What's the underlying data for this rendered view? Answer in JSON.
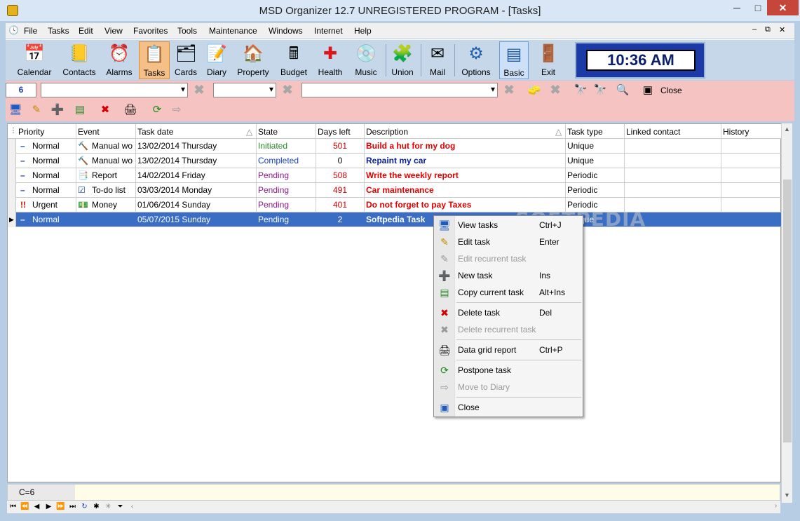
{
  "window": {
    "title": "MSD Organizer 12.7 UNREGISTERED PROGRAM - [Tasks]",
    "min_glyph": "─",
    "max_glyph": "□",
    "close_glyph": "✕"
  },
  "menubar": {
    "items": [
      "File",
      "Tasks",
      "Edit",
      "View",
      "Favorites",
      "Tools",
      "Maintenance",
      "Windows",
      "Internet",
      "Help"
    ],
    "mdi": [
      "–",
      "⧉",
      "✕"
    ]
  },
  "toolbar": {
    "buttons": [
      {
        "label": "Calendar",
        "icon": "calendar-icon",
        "glyph": "📅"
      },
      {
        "label": "Contacts",
        "icon": "contacts-icon",
        "glyph": "📒"
      },
      {
        "label": "Alarms",
        "icon": "alarm-clock-icon",
        "glyph": "⏰"
      },
      {
        "label": "Tasks",
        "icon": "tasks-icon",
        "glyph": "📋"
      },
      {
        "label": "Cards",
        "icon": "cards-icon",
        "glyph": "🗂"
      },
      {
        "label": "Diary",
        "icon": "diary-icon",
        "glyph": "📝"
      },
      {
        "label": "Property",
        "icon": "house-icon",
        "glyph": "🏠"
      },
      {
        "label": "Budget",
        "icon": "calculator-icon",
        "glyph": "🖩"
      },
      {
        "label": "Health",
        "icon": "health-cross-icon",
        "glyph": "✚"
      },
      {
        "label": "Music",
        "icon": "music-cd-icon",
        "glyph": "💿"
      },
      {
        "label": "Union",
        "icon": "puzzle-icon",
        "glyph": "🧩"
      },
      {
        "label": "Mail",
        "icon": "mail-envelope-icon",
        "glyph": "✉"
      },
      {
        "label": "Options",
        "icon": "options-gear-icon",
        "glyph": "⚙"
      },
      {
        "label": "Basic",
        "icon": "basic-view-icon",
        "glyph": "▤"
      },
      {
        "label": "Exit",
        "icon": "exit-door-icon",
        "glyph": "🚪"
      }
    ],
    "clock": "10:36 AM"
  },
  "filterbar": {
    "count_value": "6",
    "close_label": "Close"
  },
  "grid": {
    "columns": [
      "Priority",
      "Event",
      "Task date",
      "State",
      "Days left",
      "Description",
      "Task type",
      "Linked contact",
      "History"
    ],
    "rows": [
      {
        "priority": "Normal",
        "priority_mark": "–",
        "event": "Manual wo",
        "event_icon": "hammer-icon",
        "event_glyph": "🔨",
        "date": "13/02/2014 Thursday",
        "state": "Initiated",
        "state_color": "#2a8a2a",
        "days": "501",
        "days_color": "#d40000",
        "desc": "Build a hut for my dog",
        "desc_color": "#e00000",
        "type": "Unique",
        "linked": "",
        "history": ""
      },
      {
        "priority": "Normal",
        "priority_mark": "–",
        "event": "Manual wo",
        "event_icon": "hammer-icon",
        "event_glyph": "🔨",
        "date": "13/02/2014 Thursday",
        "state": "Completed",
        "state_color": "#1a3fc4",
        "days": "0",
        "days_color": "#000000",
        "desc": "Repaint my car",
        "desc_color": "#0a1f9a",
        "type": "Unique",
        "linked": "",
        "history": ""
      },
      {
        "priority": "Normal",
        "priority_mark": "–",
        "event": "Report",
        "event_icon": "report-icon",
        "event_glyph": "📑",
        "date": "14/02/2014 Friday",
        "state": "Pending",
        "state_color": "#8b1a8b",
        "days": "508",
        "days_color": "#d40000",
        "desc": "Write the weekly report",
        "desc_color": "#e00000",
        "type": "Periodic",
        "linked": "",
        "history": ""
      },
      {
        "priority": "Normal",
        "priority_mark": "–",
        "event": "To-do list",
        "event_icon": "todo-list-icon",
        "event_glyph": "☑",
        "date": "03/03/2014 Monday",
        "state": "Pending",
        "state_color": "#8b1a8b",
        "days": "491",
        "days_color": "#d40000",
        "desc": "Car maintenance",
        "desc_color": "#e00000",
        "type": "Periodic",
        "linked": "",
        "history": ""
      },
      {
        "priority": "Urgent",
        "priority_mark": "!!",
        "event": "Money",
        "event_icon": "money-icon",
        "event_glyph": "💵",
        "date": "01/06/2014 Sunday",
        "state": "Pending",
        "state_color": "#8b1a8b",
        "days": "401",
        "days_color": "#d40000",
        "desc": "Do not forget to pay Taxes",
        "desc_color": "#e00000",
        "type": "Periodic",
        "linked": "",
        "history": ""
      },
      {
        "priority": "Normal",
        "priority_mark": "–",
        "event": "",
        "event_icon": "",
        "event_glyph": "",
        "date": "05/07/2015 Sunday",
        "state": "Pending",
        "state_color": "#ffffff",
        "days": "2",
        "days_color": "#ffffff",
        "desc": "Softpedia Task",
        "desc_color": "#ffffff",
        "type": "Unique",
        "linked": "",
        "history": ""
      }
    ]
  },
  "watermark": "SOFTPEDIA",
  "status": {
    "count": "C=6"
  },
  "context_menu": {
    "items": [
      {
        "label": "View tasks",
        "shortcut": "Ctrl+J",
        "icon": "monitor-icon",
        "glyph": "🖥",
        "disabled": false
      },
      {
        "label": "Edit task",
        "shortcut": "Enter",
        "icon": "edit-pencil-icon",
        "glyph": "✎",
        "disabled": false
      },
      {
        "label": "Edit recurrent task",
        "shortcut": "",
        "icon": "edit-recurrent-icon",
        "glyph": "✎",
        "disabled": true
      },
      {
        "label": "New task",
        "shortcut": "Ins",
        "icon": "new-task-icon",
        "glyph": "➕",
        "disabled": false
      },
      {
        "label": "Copy current task",
        "shortcut": "Alt+Ins",
        "icon": "copy-task-icon",
        "glyph": "▤",
        "disabled": false
      },
      {
        "label": "Delete task",
        "shortcut": "Del",
        "icon": "delete-task-icon",
        "glyph": "✖",
        "disabled": false
      },
      {
        "label": "Delete recurrent task",
        "shortcut": "",
        "icon": "delete-recurrent-icon",
        "glyph": "✖",
        "disabled": true
      },
      {
        "label": "Data grid report",
        "shortcut": "Ctrl+P",
        "icon": "printer-icon",
        "glyph": "🖨",
        "disabled": false
      },
      {
        "label": "Postpone task",
        "shortcut": "",
        "icon": "refresh-arrows-icon",
        "glyph": "⟳",
        "disabled": false
      },
      {
        "label": "Move to Diary",
        "shortcut": "",
        "icon": "move-diary-icon",
        "glyph": "⇨",
        "disabled": true
      },
      {
        "label": "Close",
        "shortcut": "",
        "icon": "close-window-icon",
        "glyph": "▣",
        "disabled": false
      }
    ]
  }
}
